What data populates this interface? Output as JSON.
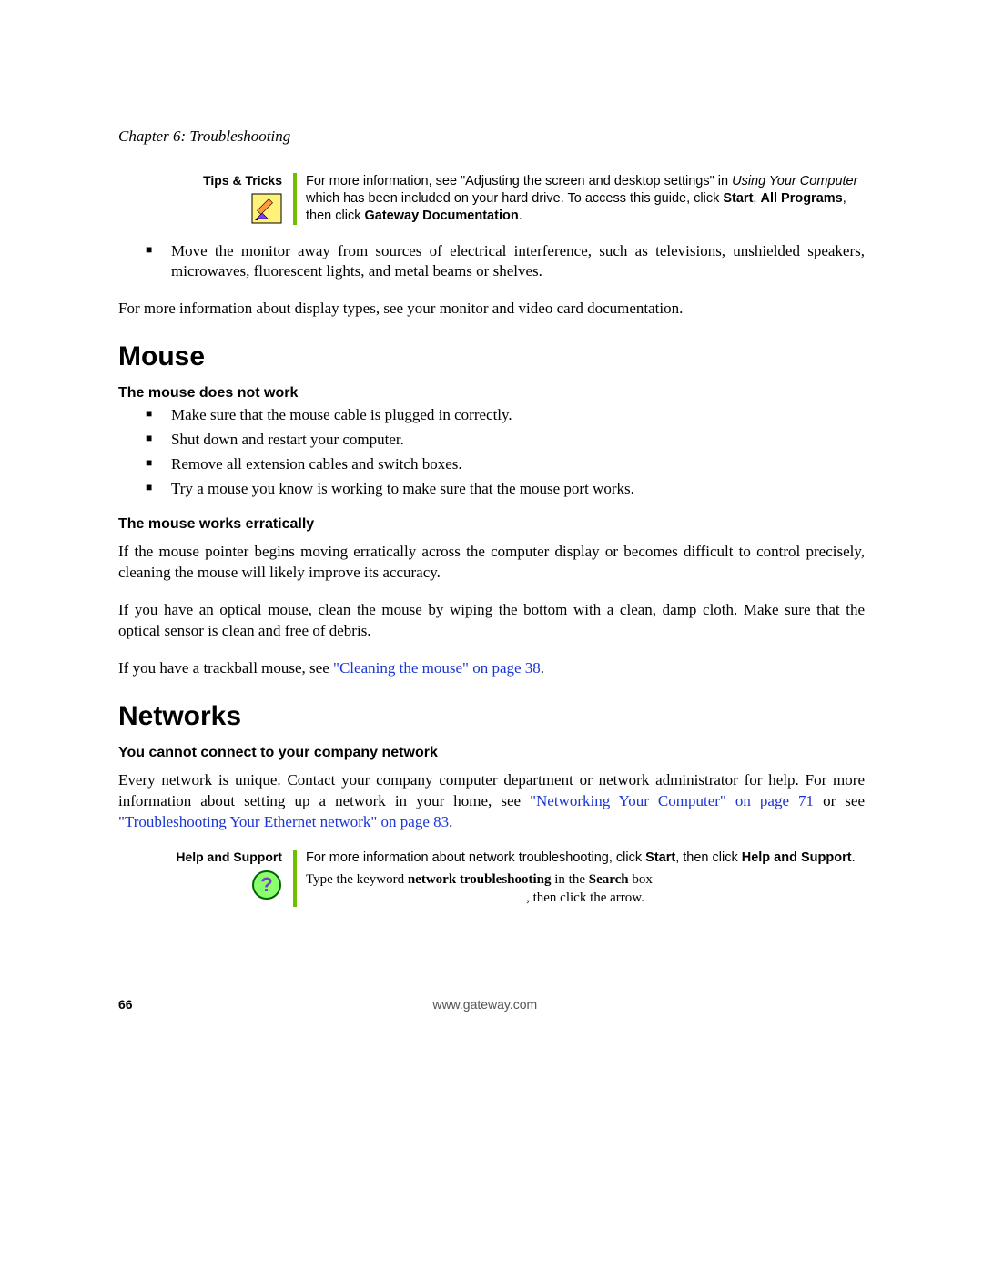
{
  "chapter_header": "Chapter 6: Troubleshooting",
  "tips_box": {
    "label": "Tips & Tricks",
    "line1_a": "For more information, see \"Adjusting the screen and desktop settings\" in ",
    "line1_i": "Using Your Computer",
    "line1_b": " which has been included on your hard drive. To access this guide, click ",
    "bold1": "Start",
    "sep1": ", ",
    "bold2": "All Programs",
    "sep2": ", then click ",
    "bold3": "Gateway Documentation",
    "end": "."
  },
  "top_bullet": "Move the monitor away from sources of electrical interference, such as televisions, unshielded speakers, microwaves, fluorescent lights, and metal beams or shelves.",
  "top_para": "For more information about display types, see your monitor and video card documentation.",
  "mouse": {
    "heading": "Mouse",
    "sub1": "The mouse does not work",
    "items": [
      "Make sure that the mouse cable is plugged in correctly.",
      "Shut down and restart your computer.",
      "Remove all extension cables and switch boxes.",
      "Try a mouse you know is working to make sure that the mouse port works."
    ],
    "sub2": "The mouse works erratically",
    "para1": "If the mouse pointer begins moving erratically across the computer display or becomes difficult to control precisely, cleaning the mouse will likely improve its accuracy.",
    "para2": "If you have an optical mouse, clean the mouse by wiping the bottom with a clean, damp cloth. Make sure that the optical sensor is clean and free of debris.",
    "para3_a": "If you have a trackball mouse, see ",
    "para3_link": "\"Cleaning the mouse\" on page 38",
    "para3_b": "."
  },
  "networks": {
    "heading": "Networks",
    "sub1": "You cannot connect to your company network",
    "para_a": "Every network is unique. Contact your company computer department or network administrator for help. For more information about setting up a network in your home, see ",
    "link1": "\"Networking Your Computer\" on page 71",
    "mid": " or see ",
    "link2": "\"Troubleshooting Your Ethernet network\" on page 83",
    "end": "."
  },
  "help_box": {
    "label": "Help and Support",
    "l1_a": "For more information about network troubleshooting, click ",
    "l1_b1": "Start",
    "l1_b": ", then click ",
    "l1_b2": "Help and Support",
    "l1_c": ".",
    "l2_a": "Type the keyword ",
    "l2_kw": "network troubleshooting",
    "l2_b": " in the ",
    "l2_bx": "Search",
    "l2_c": " box",
    "l3": ", then click the arrow."
  },
  "footer": {
    "page": "66",
    "url": "www.gateway.com"
  }
}
